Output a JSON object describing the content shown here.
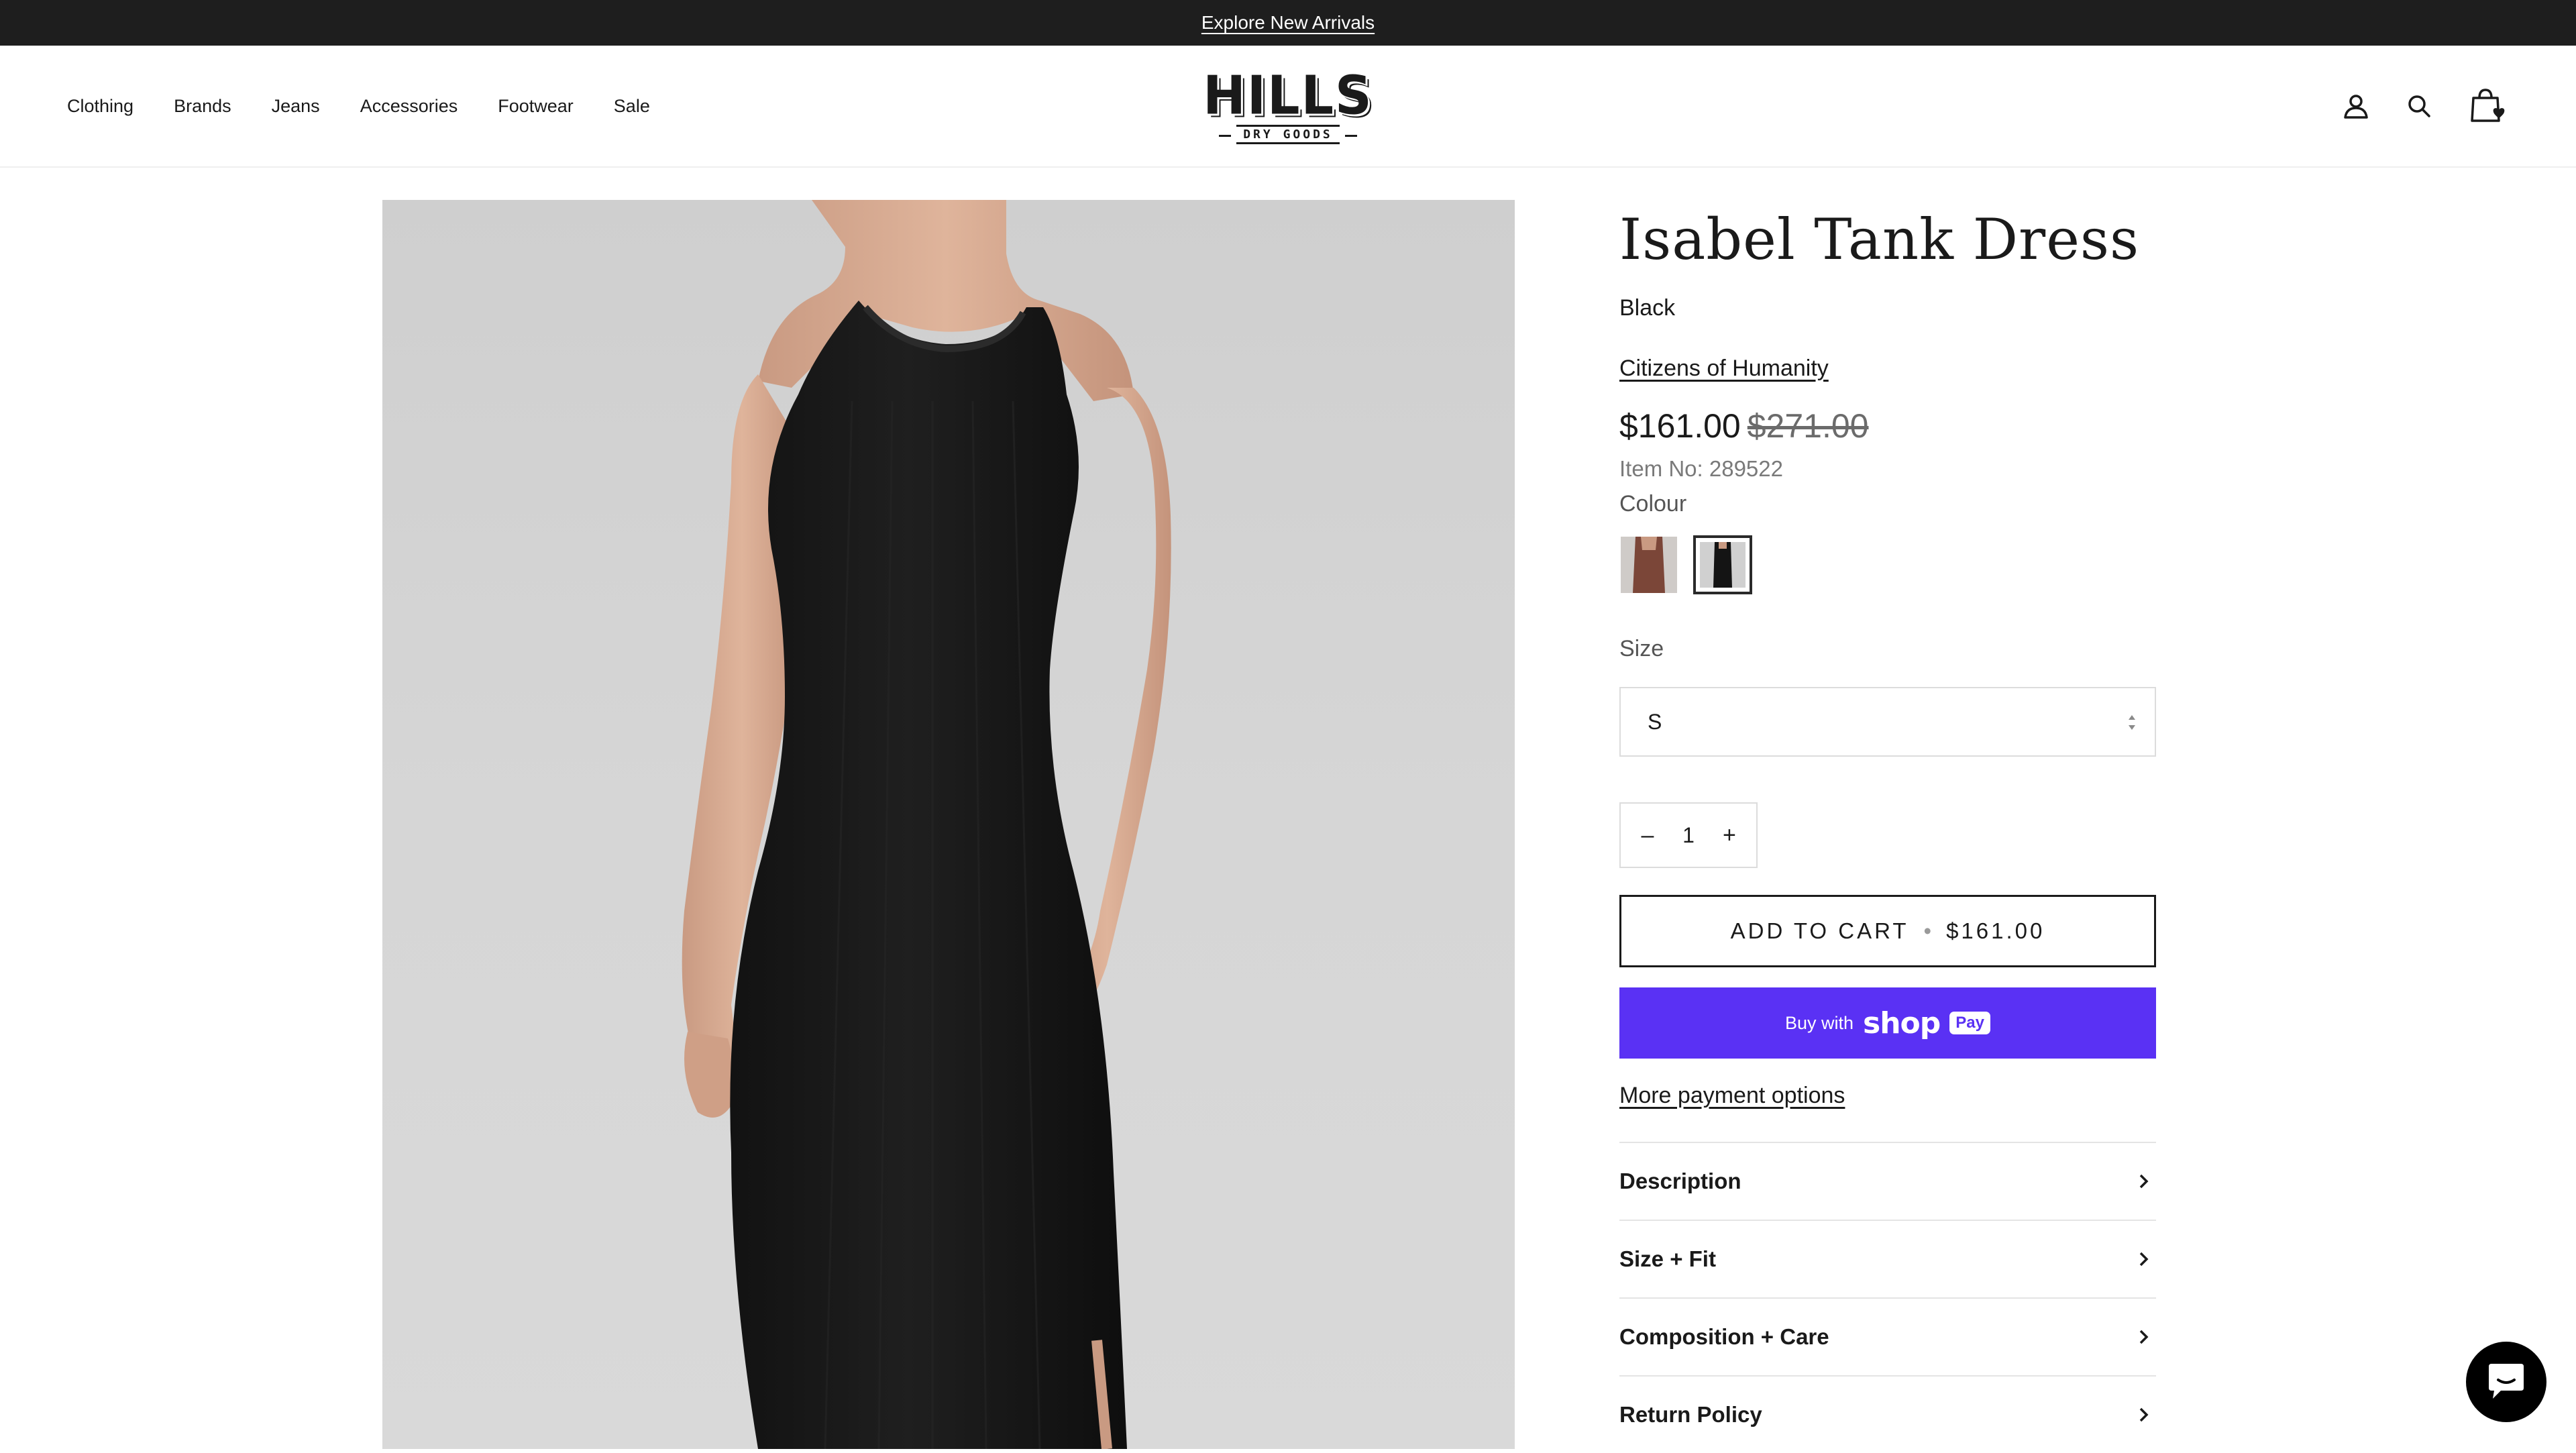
{
  "announcement": {
    "text": "Explore New Arrivals"
  },
  "nav": {
    "items": [
      {
        "label": "Clothing"
      },
      {
        "label": "Brands"
      },
      {
        "label": "Jeans"
      },
      {
        "label": "Accessories"
      },
      {
        "label": "Footwear"
      },
      {
        "label": "Sale"
      }
    ]
  },
  "logo": {
    "main": "HILLS",
    "sub": "DRY GOODS"
  },
  "header_icons": [
    "account-icon",
    "search-icon",
    "cart-icon"
  ],
  "product": {
    "title": "Isabel Tank Dress",
    "color_name": "Black",
    "brand": "Citizens of Humanity",
    "price": "$161.00",
    "compare_price": "$271.00",
    "item_no": "Item No: 289522",
    "colour_label": "Colour",
    "swatches": [
      {
        "name": "brown",
        "color": "#7b4638",
        "selected": false
      },
      {
        "name": "black",
        "color": "#1a1a1a",
        "selected": true
      }
    ],
    "size_label": "Size",
    "size_value": "S",
    "quantity": "1",
    "qty_minus": "–",
    "qty_plus": "+",
    "add_to_cart": "ADD TO CART",
    "add_to_cart_sep": "•",
    "add_to_cart_price": "$161.00",
    "shop_pay": {
      "buy_with": "Buy with",
      "shop": "shop",
      "pay": "Pay"
    },
    "more_payment": "More payment options"
  },
  "accordion": [
    {
      "label": "Description"
    },
    {
      "label": "Size + Fit"
    },
    {
      "label": "Composition + Care"
    },
    {
      "label": "Return Policy"
    }
  ],
  "colors": {
    "announcement_bg": "#1e1e1e",
    "shop_pay_bg": "#5a31f4",
    "image_bg": "#d3d3d3"
  }
}
